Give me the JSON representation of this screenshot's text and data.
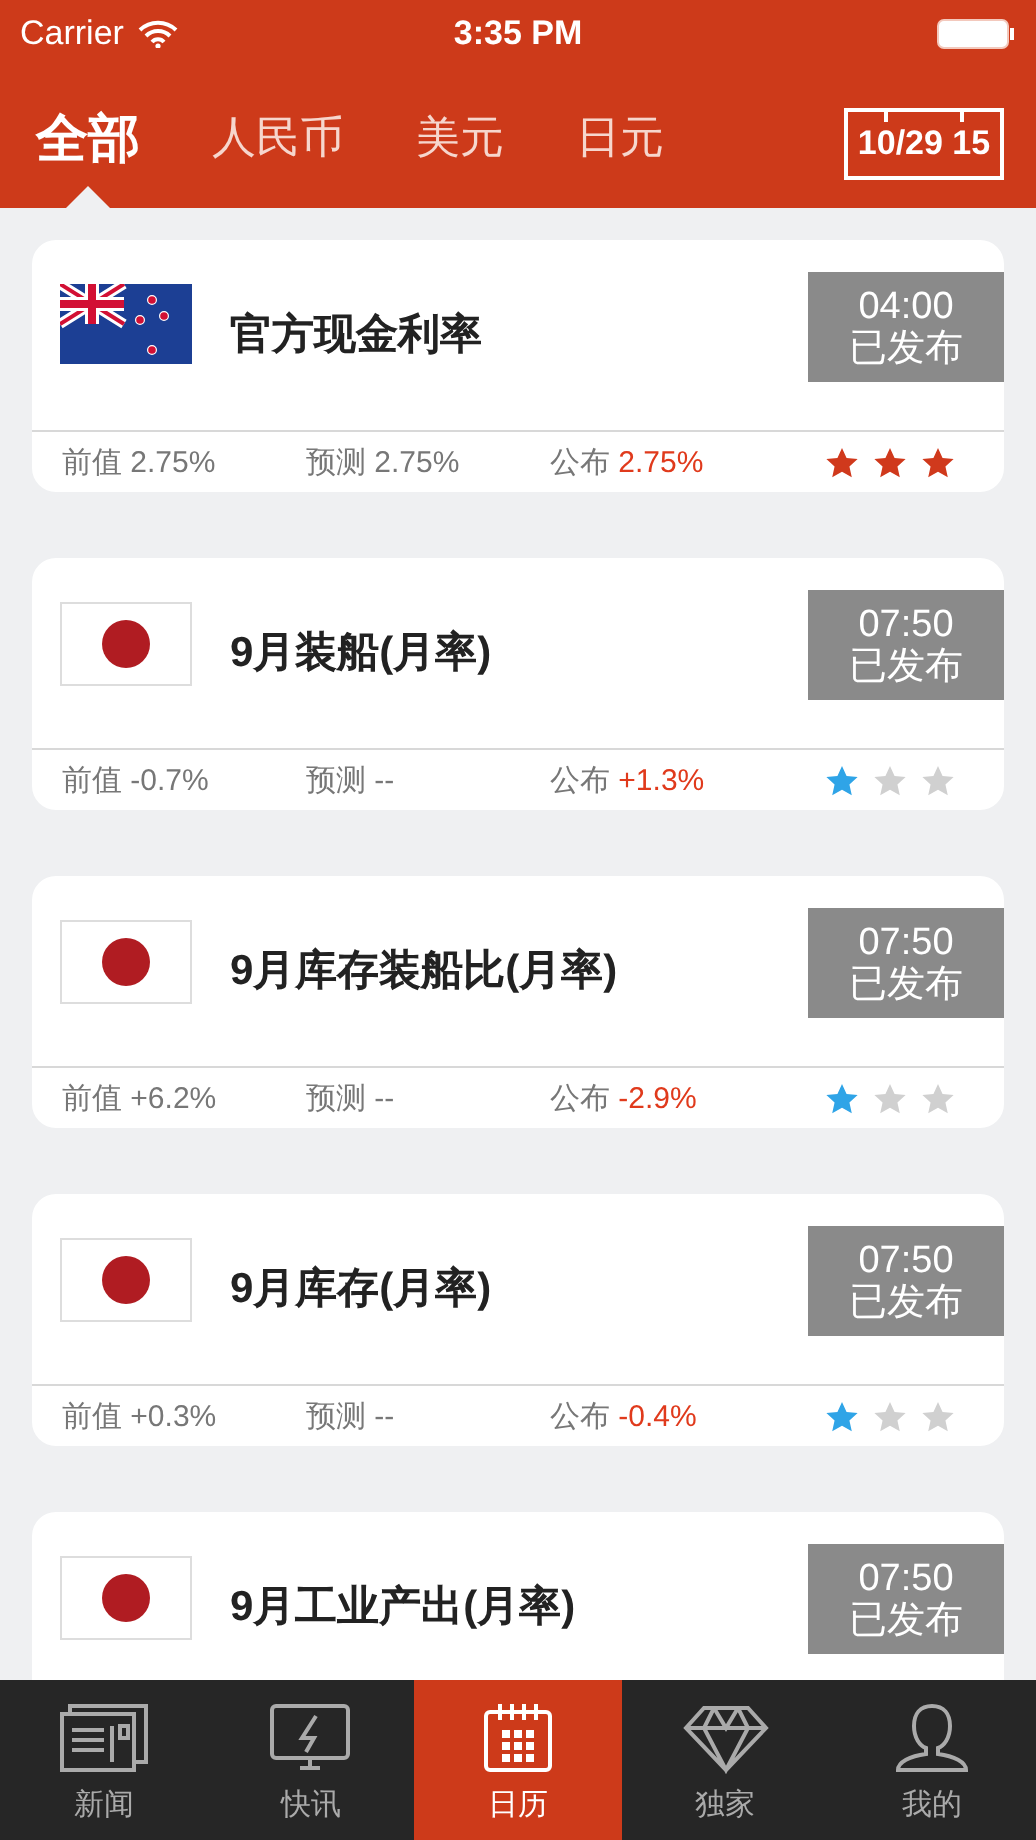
{
  "status_bar": {
    "carrier": "Carrier",
    "time": "3:35 PM"
  },
  "tabs": [
    {
      "label": "全部",
      "selected": true
    },
    {
      "label": "人民币",
      "selected": false
    },
    {
      "label": "美元",
      "selected": false
    },
    {
      "label": "日元",
      "selected": false
    }
  ],
  "date_button": "10/29 15",
  "events": [
    {
      "kind": "nz",
      "title": "官方现金利率",
      "time": "04:00",
      "status": "已发布",
      "previous": {
        "label": "前值",
        "value": "2.75%"
      },
      "forecast": {
        "label": "预测",
        "value": "2.75%"
      },
      "actual": {
        "label": "公布",
        "value": "2.75%"
      },
      "stars": 3,
      "color": "#d0391c"
    },
    {
      "kind": "jp",
      "title": "9月装船(月率)",
      "time": "07:50",
      "status": "已发布",
      "previous": {
        "label": "前值",
        "value": "-0.7%"
      },
      "forecast": {
        "label": "预测",
        "value": "--"
      },
      "actual": {
        "label": "公布",
        "value": "+1.3%"
      },
      "stars": 1,
      "color": "#2fa4e7"
    },
    {
      "kind": "jp",
      "title": "9月库存装船比(月率)",
      "time": "07:50",
      "status": "已发布",
      "previous": {
        "label": "前值",
        "value": "+6.2%"
      },
      "forecast": {
        "label": "预测",
        "value": "--"
      },
      "actual": {
        "label": "公布",
        "value": "-2.9%"
      },
      "stars": 1,
      "color": "#2fa4e7"
    },
    {
      "kind": "jp",
      "title": "9月库存(月率)",
      "time": "07:50",
      "status": "已发布",
      "previous": {
        "label": "前值",
        "value": "+0.3%"
      },
      "forecast": {
        "label": "预测",
        "value": "--"
      },
      "actual": {
        "label": "公布",
        "value": "-0.4%"
      },
      "stars": 1,
      "color": "#2fa4e7"
    },
    {
      "kind": "jp",
      "title": "9月工业产出(月率)",
      "time": "07:50",
      "status": "已发布"
    }
  ],
  "bottom_nav": [
    {
      "label": "新闻",
      "kind": "news",
      "selected": false
    },
    {
      "label": "快讯",
      "kind": "flash",
      "selected": false
    },
    {
      "label": "日历",
      "kind": "calendar",
      "selected": true
    },
    {
      "label": "独家",
      "kind": "diamond",
      "selected": false
    },
    {
      "label": "我的",
      "kind": "user",
      "selected": false
    }
  ]
}
